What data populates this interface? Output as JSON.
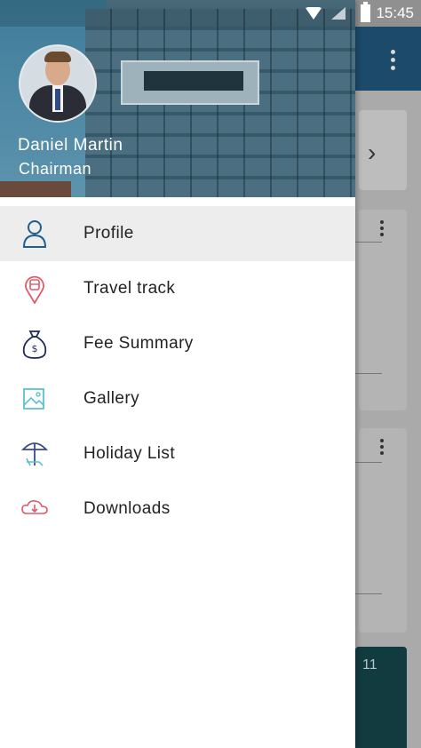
{
  "status_bar": {
    "time": "15:45"
  },
  "user": {
    "name": "Daniel Martin",
    "role": "Chairman"
  },
  "menu": {
    "items": [
      {
        "label": "Profile",
        "icon": "person-icon",
        "active": true
      },
      {
        "label": "Travel track",
        "icon": "bus-location-icon",
        "active": false
      },
      {
        "label": "Fee Summary",
        "icon": "money-bag-icon",
        "active": false
      },
      {
        "label": "Gallery",
        "icon": "image-icon",
        "active": false
      },
      {
        "label": "Holiday List",
        "icon": "beach-umbrella-icon",
        "active": false
      },
      {
        "label": "Downloads",
        "icon": "cloud-download-icon",
        "active": false
      }
    ]
  },
  "background": {
    "card_number": "11"
  },
  "colors": {
    "toolbar": "#1b4a6b",
    "icon_blue": "#1f5f8f",
    "icon_red": "#e05a6a",
    "icon_teal": "#5cc3c9",
    "icon_navy": "#1e2a5a"
  }
}
